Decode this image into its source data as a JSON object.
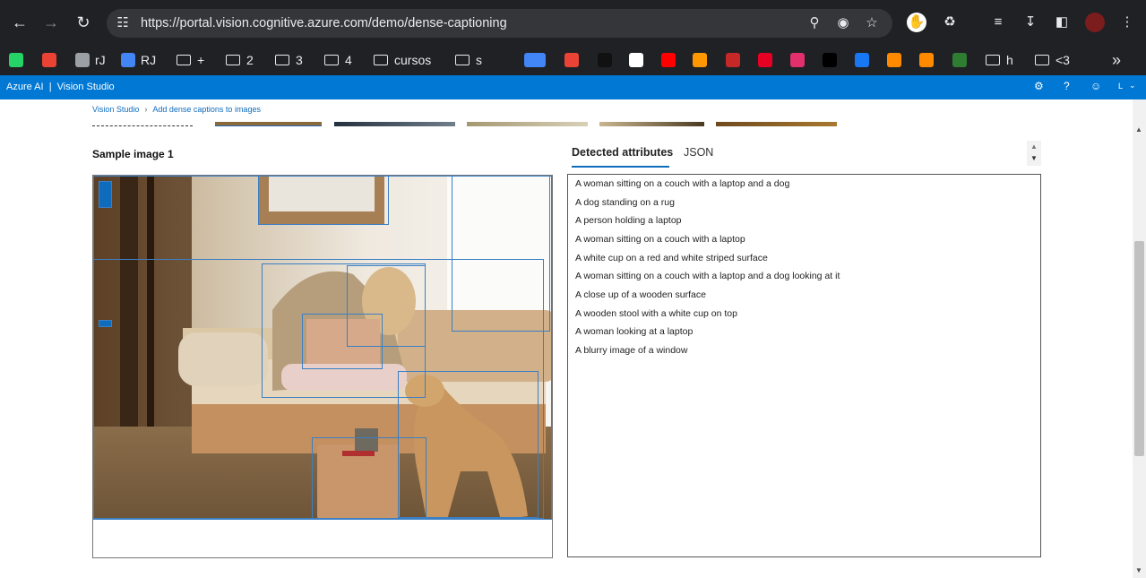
{
  "browser": {
    "url": "https://portal.vision.cognitive.azure.com/demo/dense-captioning",
    "bookmarks": [
      {
        "label": "",
        "icon": "whatsapp-icon",
        "color": "#25d366"
      },
      {
        "label": "",
        "icon": "gmail-icon",
        "color": "#ea4335"
      },
      {
        "label": "rJ",
        "icon": "globe-icon",
        "color": "#9aa0a6"
      },
      {
        "label": "RJ",
        "icon": "g-icon",
        "color": "#4285f4"
      },
      {
        "label": "+",
        "icon": "folder-icon"
      },
      {
        "label": "2",
        "icon": "folder-icon"
      },
      {
        "label": "3",
        "icon": "folder-icon"
      },
      {
        "label": "4",
        "icon": "folder-icon"
      },
      {
        "label": "cursos",
        "icon": "folder-icon"
      },
      {
        "label": "s",
        "icon": "folder-icon"
      },
      {
        "label": "",
        "icon": "calendar-icon",
        "color": "#4285f4"
      },
      {
        "label": "",
        "icon": "translate-icon",
        "color": "#4285f4"
      },
      {
        "label": "",
        "icon": "assistant-icon",
        "color": "#ea4335"
      },
      {
        "label": "",
        "icon": "k-icon",
        "color": "#111111"
      },
      {
        "label": "",
        "icon": "amazon-icon",
        "color": "#ffffff"
      },
      {
        "label": "",
        "icon": "youtube-music-icon",
        "color": "#ff0000"
      },
      {
        "label": "",
        "icon": "orange-circle-icon",
        "color": "#ff9800"
      },
      {
        "label": "",
        "icon": "red-swirl-icon",
        "color": "#c62828"
      },
      {
        "label": "",
        "icon": "pinterest-icon",
        "color": "#e60023"
      },
      {
        "label": "",
        "icon": "instagram-icon",
        "color": "#e1306c"
      },
      {
        "label": "",
        "icon": "x-icon",
        "color": "#000000"
      },
      {
        "label": "",
        "icon": "facebook-icon",
        "color": "#1877f2"
      },
      {
        "label": "",
        "icon": "portal-icon",
        "color": "#ff8a00"
      },
      {
        "label": "",
        "icon": "portal2-icon",
        "color": "#ff8a00"
      },
      {
        "label": "",
        "icon": "e-icon",
        "color": "#2e7d32"
      },
      {
        "label": "h",
        "icon": "folder-icon"
      },
      {
        "label": "<3",
        "icon": "folder-icon"
      }
    ],
    "more_bookmarks": "»"
  },
  "appbar": {
    "title": "Azure AI  |  Vision Studio",
    "account_initial": "L"
  },
  "breadcrumb": {
    "home": "Vision Studio",
    "sep": "›",
    "current": "Add dense captions to images"
  },
  "sample": {
    "title": "Sample image 1"
  },
  "tabs": {
    "detected": "Detected attributes",
    "json": "JSON"
  },
  "attributes": [
    "A woman sitting on a couch with a laptop and a dog",
    "A dog standing on a rug",
    "A person holding a laptop",
    "A woman sitting on a couch with a laptop",
    "A white cup on a red and white striped surface",
    "A woman sitting on a couch with a laptop and a dog looking at it",
    "A close up of a wooden surface",
    "A wooden stool with a white cup on top",
    "A woman looking at a laptop",
    "A blurry image of a window"
  ],
  "colors": {
    "chrome": "#202124",
    "omnibox": "#35363a",
    "azure_blue": "#0078d4",
    "link": "#0f6cbd",
    "bbox": "#3b7fc4"
  }
}
